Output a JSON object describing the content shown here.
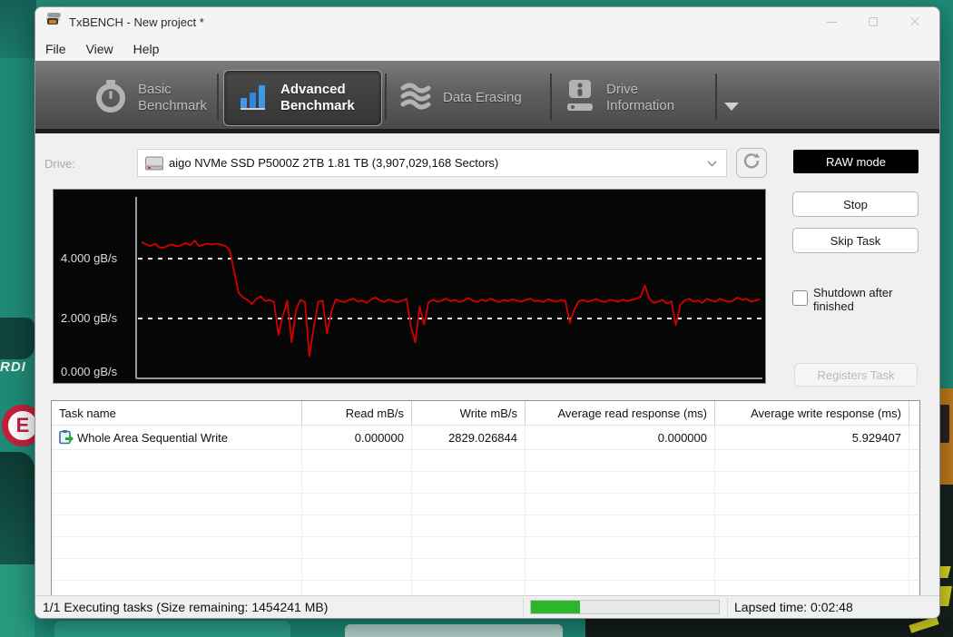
{
  "desktop": {
    "wallpaper_left_text": "RDI",
    "wallpaper_badge_letter": "E"
  },
  "titlebar": {
    "title": "TxBENCH - New project *"
  },
  "menu": {
    "items": [
      "File",
      "View",
      "Help"
    ]
  },
  "toolbar": {
    "tabs": [
      {
        "line1": "Basic",
        "line2": "Benchmark"
      },
      {
        "line1": "Advanced",
        "line2": "Benchmark"
      },
      {
        "line1": "Data Erasing",
        "line2": ""
      },
      {
        "line1": "Drive",
        "line2": "Information"
      }
    ]
  },
  "drive_row": {
    "label": "Drive:",
    "value": "aigo NVMe SSD P5000Z 2TB  1.81 TB (3,907,029,168 Sectors)",
    "raw_mode_label": "RAW mode"
  },
  "controls": {
    "stop_label": "Stop",
    "skip_task_label": "Skip Task",
    "shutdown_label": "Shutdown after finished",
    "shutdown_checked": false,
    "registers_task_label": "Registers Task"
  },
  "chart_data": {
    "type": "line",
    "ylabel": "gB/s",
    "yticks": [
      4,
      2,
      0
    ],
    "ytick_labels": [
      "4.000 gB/s",
      "2.000 gB/s",
      "0.000 gB/s"
    ],
    "ylim": [
      0,
      6.1
    ],
    "grid": "dashed-horizontal",
    "legend": "none",
    "series": [
      {
        "name": "Write throughput (gB/s)",
        "color": "#d40000",
        "values": [
          4.55,
          4.48,
          4.42,
          4.5,
          4.38,
          4.36,
          4.44,
          4.47,
          4.41,
          4.45,
          4.52,
          4.45,
          4.6,
          4.42,
          4.46,
          4.5,
          4.47,
          4.5,
          4.46,
          4.42,
          4.28,
          3.55,
          2.85,
          2.7,
          2.62,
          2.48,
          2.66,
          2.74,
          2.58,
          2.62,
          2.55,
          1.45,
          2.1,
          2.6,
          1.2,
          2.3,
          2.62,
          2.55,
          0.75,
          1.7,
          2.56,
          2.6,
          1.5,
          2.25,
          2.64,
          2.58,
          2.55,
          2.62,
          2.66,
          2.56,
          2.6,
          2.52,
          2.64,
          2.7,
          2.6,
          2.55,
          2.64,
          2.58,
          2.54,
          2.6,
          2.65,
          1.75,
          1.2,
          2.4,
          1.8,
          2.55,
          2.62,
          2.56,
          2.6,
          2.66,
          2.58,
          2.62,
          2.55,
          2.6,
          2.68,
          2.6,
          2.55,
          2.63,
          2.58,
          2.66,
          2.6,
          2.55,
          2.62,
          2.58,
          2.64,
          2.6,
          2.56,
          2.62,
          2.66,
          2.58,
          2.6,
          2.55,
          2.64,
          2.6,
          2.56,
          2.62,
          2.58,
          1.85,
          2.3,
          2.58,
          2.62,
          2.56,
          2.6,
          2.65,
          2.58,
          2.55,
          2.62,
          2.6,
          2.56,
          2.63,
          2.58,
          2.62,
          2.66,
          2.72,
          3.1,
          2.66,
          2.52,
          2.56,
          2.62,
          2.5,
          2.58,
          1.78,
          2.45,
          2.6,
          2.66,
          2.56,
          2.6,
          2.52,
          2.66,
          2.6,
          2.56,
          2.66,
          2.6,
          2.56,
          2.6,
          2.7,
          2.62,
          2.66,
          2.56,
          2.6,
          2.64
        ]
      }
    ]
  },
  "table": {
    "columns": [
      "Task name",
      "Read mB/s",
      "Write mB/s",
      "Average read response (ms)",
      "Average write response (ms)"
    ],
    "rows": [
      {
        "task": "Whole Area Sequential Write",
        "read": "0.000000",
        "write": "2829.026844",
        "avg_read": "0.000000",
        "avg_write": "5.929407"
      }
    ]
  },
  "statusbar": {
    "left": "1/1 Executing tasks (Size remaining: 1454241 MB)",
    "progress_percent": 26,
    "right": "Lapsed time: 0:02:48"
  }
}
